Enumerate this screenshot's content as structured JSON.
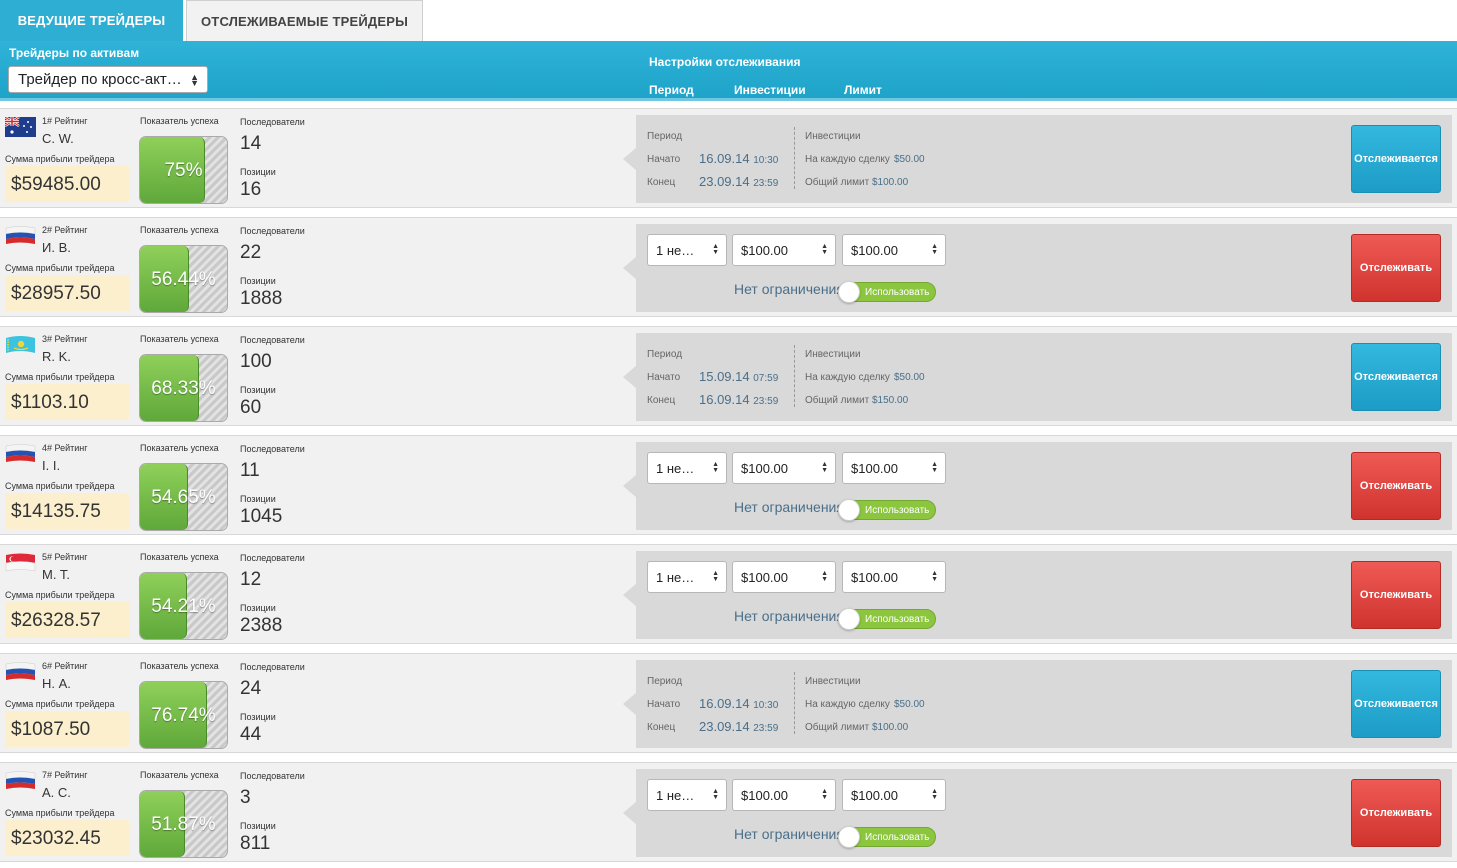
{
  "tabs": [
    {
      "label": "ВЕДУЩИЕ ТРЕЙДЕРЫ",
      "active": true
    },
    {
      "label": "ОТСЛЕЖИВАЕМЫЕ ТРЕЙДЕРЫ",
      "active": false
    }
  ],
  "header": {
    "assets_label": "Трейдеры по активам",
    "assets_select": "Трейдер по кросс-акт…",
    "tracking_settings": "Настройки отслеживания",
    "col_period": "Период",
    "col_investments": "Инвестиции",
    "col_limit": "Лимит"
  },
  "labels": {
    "rank_suffix": "# Рейтинг",
    "profit_sum": "Сумма прибыли трейдера",
    "success_rate": "Показатель успеха",
    "followers": "Последователи",
    "positions": "Позиции",
    "period": "Период",
    "start": "Начато",
    "end": "Конец",
    "investments": "Инвестиции",
    "per_trade": "На каждую сделку",
    "total_limit": "Общий лимит",
    "no_limit": "Нет ограничения",
    "use": "Использовать",
    "btn_tracked": "Отслеживается",
    "btn_track": "Отслеживать"
  },
  "colors": {
    "accent": "#2eaed3",
    "tracked_button": "#22a6cf",
    "track_button": "#e0443f",
    "success_green": "#76bd47",
    "profit_bg": "#fbefce"
  },
  "traders": [
    {
      "rank": "1# Рейтинг",
      "name": "C. W.",
      "flag": "australia-flag",
      "profit": "$59485.00",
      "success": "75%",
      "success_value": 75,
      "followers": "14",
      "positions": "16",
      "tracked": true,
      "start_date": "16.09.14",
      "start_time": "10:30",
      "end_date": "23.09.14",
      "end_time": "23:59",
      "per_trade": "$50.00",
      "total_limit": "$100.00"
    },
    {
      "rank": "2# Рейтинг",
      "name": "И. В.",
      "flag": "russia-flag",
      "profit": "$28957.50",
      "success": "56.44%",
      "success_value": 56.44,
      "followers": "22",
      "positions": "1888",
      "tracked": false,
      "period_select": "1 не…",
      "invest_select": "$100.00",
      "limit_select": "$100.00"
    },
    {
      "rank": "3# Рейтинг",
      "name": "R. K.",
      "flag": "kazakhstan-flag",
      "profit": "$1103.10",
      "success": "68.33%",
      "success_value": 68.33,
      "followers": "100",
      "positions": "60",
      "tracked": true,
      "start_date": "15.09.14",
      "start_time": "07:59",
      "end_date": "16.09.14",
      "end_time": "23:59",
      "per_trade": "$50.00",
      "total_limit": "$150.00"
    },
    {
      "rank": "4# Рейтинг",
      "name": "I. I.",
      "flag": "russia-flag",
      "profit": "$14135.75",
      "success": "54.65%",
      "success_value": 54.65,
      "followers": "11",
      "positions": "1045",
      "tracked": false,
      "period_select": "1 не…",
      "invest_select": "$100.00",
      "limit_select": "$100.00"
    },
    {
      "rank": "5# Рейтинг",
      "name": "M. T.",
      "flag": "singapore-flag",
      "profit": "$26328.57",
      "success": "54.21%",
      "success_value": 54.21,
      "followers": "12",
      "positions": "2388",
      "tracked": false,
      "period_select": "1 не…",
      "invest_select": "$100.00",
      "limit_select": "$100.00"
    },
    {
      "rank": "6# Рейтинг",
      "name": "Н. А.",
      "flag": "russia-flag",
      "profit": "$1087.50",
      "success": "76.74%",
      "success_value": 76.74,
      "followers": "24",
      "positions": "44",
      "tracked": true,
      "start_date": "16.09.14",
      "start_time": "10:30",
      "end_date": "23.09.14",
      "end_time": "23:59",
      "per_trade": "$50.00",
      "total_limit": "$100.00"
    },
    {
      "rank": "7# Рейтинг",
      "name": "А. С.",
      "flag": "russia-flag",
      "profit": "$23032.45",
      "success": "51.87%",
      "success_value": 51.87,
      "followers": "3",
      "positions": "811",
      "tracked": false,
      "period_select": "1 не…",
      "invest_select": "$100.00",
      "limit_select": "$100.00"
    }
  ]
}
